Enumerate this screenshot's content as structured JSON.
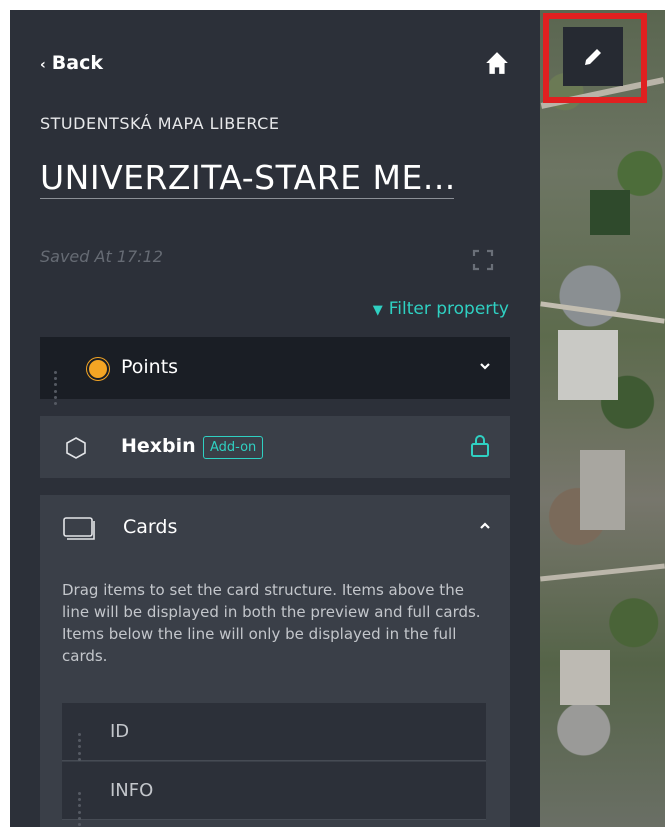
{
  "header": {
    "back_label": "Back",
    "home_icon": "home-icon"
  },
  "project_name": "STUDENTSKÁ MAPA LIBERCE",
  "map_title": "UNIVERZITA-STARE ME...",
  "saved_status": "Saved At 17:12",
  "filter_label": "Filter property",
  "layers": {
    "points": {
      "label": "Points",
      "color": "#f4a524"
    },
    "hexbin": {
      "label": "Hexbin",
      "badge": "Add-on"
    },
    "cards": {
      "label": "Cards",
      "description": "Drag items to set the card structure. Items above the line will be displayed in both the preview and full cards. Items below the line will only be displayed in the full cards.",
      "fields": [
        "ID",
        "INFO"
      ]
    }
  },
  "colors": {
    "accent": "#2fd0c2",
    "panel": "#2c3039",
    "highlight": "#e02020"
  }
}
